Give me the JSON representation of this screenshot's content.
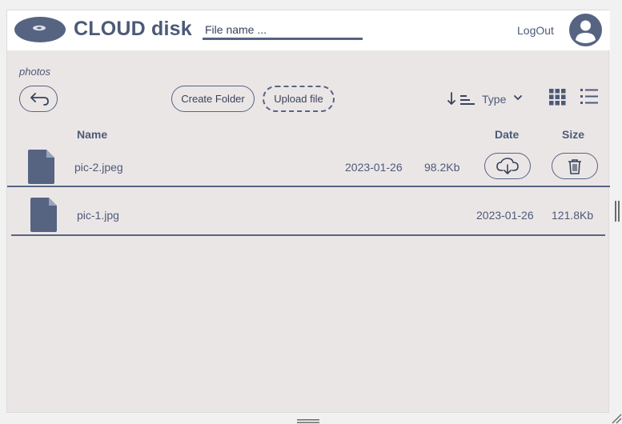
{
  "header": {
    "brand": "CLOUD disk",
    "search_placeholder": "File name ...",
    "logout_label": "LogOut"
  },
  "toolbar": {
    "breadcrumb": "photos",
    "create_folder_label": "Create Folder",
    "upload_file_label": "Upload file",
    "sort_label": "Type"
  },
  "columns": {
    "name": "Name",
    "date": "Date",
    "size": "Size"
  },
  "files": [
    {
      "name": "pic-2.jpeg",
      "date": "2023-01-26",
      "size": "98.2Kb"
    },
    {
      "name": "pic-1.jpg",
      "date": "2023-01-26",
      "size": "121.8Kb"
    }
  ],
  "colors": {
    "accent": "#566482",
    "text": "#4c5a78",
    "panel": "#ebe6e6",
    "header_bg": "#ffffff"
  },
  "icons": [
    "disk-logo-icon",
    "user-avatar-icon",
    "back-arrow-icon",
    "sort-icon",
    "chevron-down-icon",
    "grid-view-icon",
    "list-view-icon",
    "file-icon",
    "download-cloud-icon",
    "trash-icon"
  ]
}
